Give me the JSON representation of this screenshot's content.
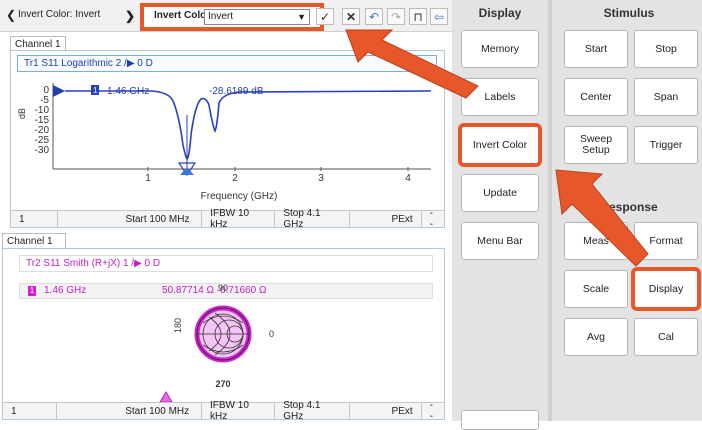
{
  "toolbar": {
    "back_label": "Invert Color:  Invert",
    "invert_color_label": "Invert Color",
    "invert_select_value": "Invert"
  },
  "channel1": {
    "tab": "Channel 1",
    "trace_header": "Tr1  S11  Logarithmic  2 /▶  0  D",
    "marker_num": "1",
    "marker_freq": "1.46 GHz",
    "marker_val": "-28.6189 dB",
    "y_ticks": [
      "0",
      "-5",
      "-10",
      "-15",
      "-20",
      "-25",
      "-30"
    ],
    "y_unit": "dB",
    "x_ticks": [
      "1",
      "2",
      "3",
      "4"
    ],
    "x_label": "Frequency (GHz)",
    "status": [
      "1",
      "Start 100 MHz",
      "IFBW 10 kHz",
      "Stop 4.1 GHz",
      "PExt",
      "--"
    ]
  },
  "channel2": {
    "tab": "Channel 1",
    "trace_header": "Tr2  S11  Smith (R+jX)  1 /▶  0  D",
    "marker_num": "1",
    "marker_freq": "1.46 GHz",
    "marker_val": "50.87714 Ω  -0.71660 Ω",
    "smith_top": "90",
    "smith_left": "180",
    "smith_right": "0",
    "smith_bottom": "270",
    "status": [
      "1",
      "Start 100 MHz",
      "IFBW 10 kHz",
      "Stop 4.1 GHz",
      "PExt",
      "--"
    ]
  },
  "panel": {
    "display_head": "Display",
    "stimulus_head": "Stimulus",
    "response_head": "Response",
    "display_buttons": [
      "Memory",
      "Labels",
      "Invert Color",
      "Update",
      "Menu Bar"
    ],
    "stimulus_buttons": [
      "Start",
      "Stop",
      "Center",
      "Span",
      "Sweep Setup",
      "Trigger"
    ],
    "response_buttons": [
      "Meas",
      "Format",
      "Scale",
      "Display",
      "Avg",
      "Cal"
    ]
  },
  "colors": {
    "highlight": "#e8572a",
    "trace1": "#2a3fbf",
    "trace2": "#d41fd4"
  }
}
